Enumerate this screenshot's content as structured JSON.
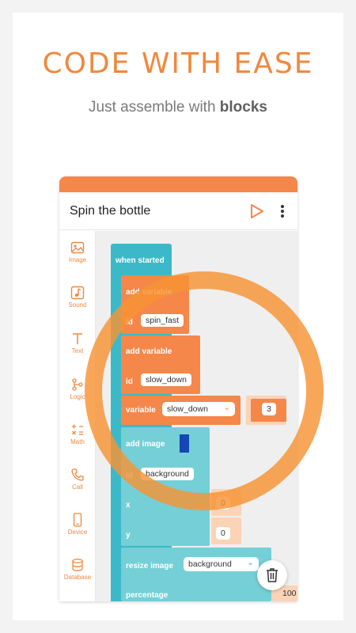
{
  "promo": {
    "headline": "CODE WITH EASE",
    "sub_prefix": "Just assemble with",
    "sub_bold": "blocks"
  },
  "app": {
    "title": "Spin the bottle",
    "play_icon": "play-icon",
    "menu_icon": "more-vert-icon",
    "accent": "#f5874a"
  },
  "palette": [
    {
      "label": "Image",
      "icon": "image-icon"
    },
    {
      "label": "Sound",
      "icon": "music-note-icon"
    },
    {
      "label": "Text",
      "icon": "text-icon"
    },
    {
      "label": "Logic",
      "icon": "logic-icon"
    },
    {
      "label": "Math",
      "icon": "math-icon"
    },
    {
      "label": "Call",
      "icon": "phone-icon"
    },
    {
      "label": "Device",
      "icon": "device-icon"
    },
    {
      "label": "Database",
      "icon": "database-icon"
    }
  ],
  "blocks": {
    "when_started": "when started",
    "add_variable_1": "add variable",
    "id_1_label": "id",
    "id_1_value": "spin_fast",
    "add_variable_2": "add variable",
    "id_2_label": "id",
    "id_2_value": "slow_down",
    "variable_label": "variable",
    "variable_select": "slow_down",
    "variable_value": "3",
    "add_image": "add image",
    "image_id_label": "id",
    "image_id_value": "background",
    "x_label": "x",
    "x_value": "0",
    "y_label": "y",
    "y_value": "0",
    "resize_image": "resize image",
    "resize_select": "background",
    "percentage_label": "percentage",
    "percentage_value": "100"
  },
  "colors": {
    "teal": "#3cb9c8",
    "teal_light": "#75cfd6",
    "orange": "#f5874a",
    "ring": "#f79434"
  }
}
